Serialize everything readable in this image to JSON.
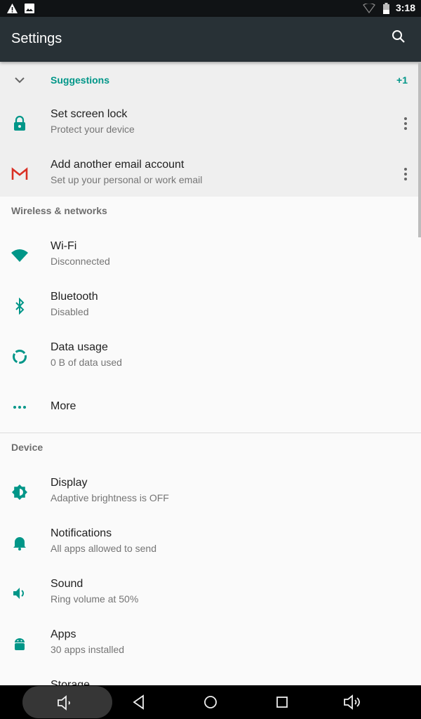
{
  "status_bar": {
    "time": "3:18",
    "icons": [
      "warning-icon",
      "image-icon",
      "wifi-outline-icon",
      "battery-icon"
    ]
  },
  "toolbar": {
    "title": "Settings",
    "search_icon": "search-icon"
  },
  "suggestions": {
    "label": "Suggestions",
    "count": "+1",
    "items": [
      {
        "title": "Set screen lock",
        "subtitle": "Protect your device",
        "icon": "lock-icon"
      },
      {
        "title": "Add another email account",
        "subtitle": "Set up your personal or work email",
        "icon": "gmail-icon"
      }
    ]
  },
  "sections": [
    {
      "header": "Wireless & networks",
      "items": [
        {
          "title": "Wi-Fi",
          "subtitle": "Disconnected",
          "icon": "wifi-icon"
        },
        {
          "title": "Bluetooth",
          "subtitle": "Disabled",
          "icon": "bluetooth-icon"
        },
        {
          "title": "Data usage",
          "subtitle": "0 B of data used",
          "icon": "data-usage-icon"
        },
        {
          "title": "More",
          "icon": "more-horiz-icon"
        }
      ]
    },
    {
      "header": "Device",
      "items": [
        {
          "title": "Display",
          "subtitle": "Adaptive brightness is OFF",
          "icon": "brightness-icon"
        },
        {
          "title": "Notifications",
          "subtitle": "All apps allowed to send",
          "icon": "bell-icon"
        },
        {
          "title": "Sound",
          "subtitle": "Ring volume at 50%",
          "icon": "volume-icon"
        },
        {
          "title": "Apps",
          "subtitle": "30 apps installed",
          "icon": "android-icon"
        },
        {
          "title": "Storage",
          "icon": "storage-icon"
        }
      ]
    }
  ],
  "colors": {
    "accent": "#009688",
    "toolbar": "#283136"
  }
}
